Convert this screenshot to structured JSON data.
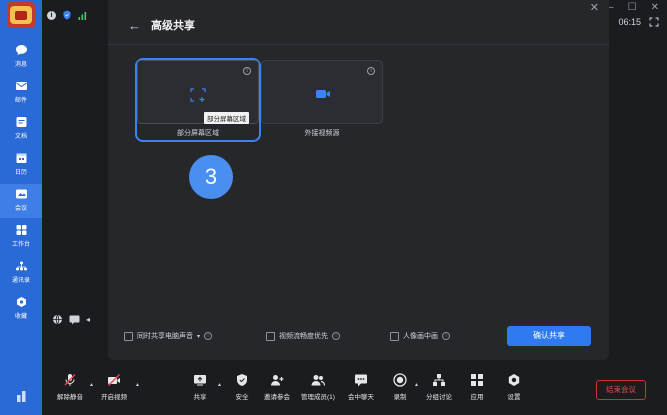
{
  "sidebar": {
    "items": [
      {
        "label": "消息",
        "icon": "chat-icon"
      },
      {
        "label": "邮件",
        "icon": "mail-icon"
      },
      {
        "label": "文档",
        "icon": "doc-icon"
      },
      {
        "label": "日历",
        "icon": "calendar-icon"
      },
      {
        "label": "会议",
        "icon": "meeting-icon"
      },
      {
        "label": "工作台",
        "icon": "apps-icon"
      },
      {
        "label": "通讯录",
        "icon": "contacts-icon"
      },
      {
        "label": "收藏",
        "icon": "favorite-icon"
      }
    ],
    "active_index": 4
  },
  "top": {
    "time": "06:15"
  },
  "dialog": {
    "title": "高级共享",
    "sources": [
      {
        "label": "部分屏幕区域",
        "selected": true,
        "tooltip": "部分屏幕区域"
      },
      {
        "label": "外接视频源",
        "selected": false
      }
    ],
    "step_number": "3",
    "options": {
      "share_audio": "同时共享电脑声音",
      "video_priority": "视频流畅度优先",
      "portrait": "人像画中画"
    },
    "confirm_label": "确认共享"
  },
  "toolbar": {
    "items": [
      {
        "label": "解除静音",
        "icon": "mic-muted-icon"
      },
      {
        "label": "开启视频",
        "icon": "camera-off-icon"
      },
      {
        "label": "共享",
        "icon": "share-screen-icon"
      },
      {
        "label": "安全",
        "icon": "shield-icon"
      },
      {
        "label": "邀请参会",
        "icon": "add-user-icon"
      },
      {
        "label": "管理成员(1)",
        "icon": "members-icon"
      },
      {
        "label": "会中聊天",
        "icon": "chat-bubble-icon"
      },
      {
        "label": "录制",
        "icon": "record-icon"
      },
      {
        "label": "分组讨论",
        "icon": "breakout-icon"
      },
      {
        "label": "应用",
        "icon": "apps-icon"
      },
      {
        "label": "设置",
        "icon": "settings-icon"
      }
    ],
    "end_label": "结束会议"
  },
  "colors": {
    "sidebar": "#2a6ad6",
    "accent": "#2f7af0",
    "danger": "#e84a50",
    "dialog_bg": "#26272b"
  }
}
